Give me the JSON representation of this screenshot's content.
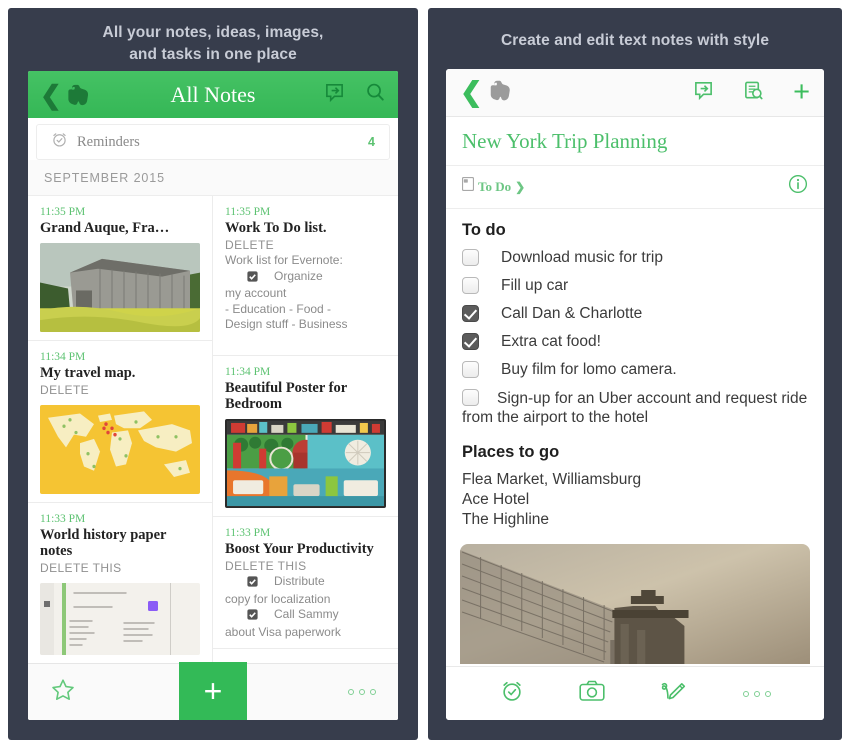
{
  "captions": {
    "left": "All your notes, ideas, images,\nand tasks in one place",
    "right": "Create and edit text notes with style"
  },
  "left_phone": {
    "navbar": {
      "back_icon": "chevron-left-icon",
      "logo_icon": "evernote-elephant-icon",
      "title": "All Notes",
      "share_icon": "share-icon",
      "search_icon": "search-icon"
    },
    "reminders": {
      "icon": "alarm-check-icon",
      "label": "Reminders",
      "count": "4"
    },
    "section_header": "SEPTEMBER 2015",
    "notes": [
      {
        "time": "11:35 PM",
        "title": "Grand Auque, Fra…",
        "subtitle": "",
        "body": "",
        "thumb": "barn-photo"
      },
      {
        "time": "11:35 PM",
        "title": "Work To Do list.",
        "subtitle": "DELETE",
        "body_line1": "Work list for Evernote:",
        "body_check1": "Organize",
        "body_line2": "my account",
        "body_line3": "- Education - Food -",
        "body_line4": "Design stuff - Business",
        "thumb": ""
      },
      {
        "time": "11:34 PM",
        "title": "My travel map.",
        "subtitle": "DELETE",
        "body": "",
        "thumb": "world-map"
      },
      {
        "time": "11:34 PM",
        "title": "Beautiful  Poster for Bedroom",
        "subtitle": "",
        "body": "",
        "thumb": "city-poster"
      },
      {
        "time": "11:33 PM",
        "title": "World history paper notes",
        "subtitle": "DELETE THIS",
        "body": "",
        "thumb": "handwritten-notes"
      },
      {
        "time": "11:33 PM",
        "title": "Boost Your Productivity",
        "subtitle": "DELETE THIS",
        "body_check1": "Distribute",
        "body_line2": "copy for localization",
        "body_check2": "Call Sammy",
        "body_line4": "about Visa paperwork",
        "thumb": ""
      }
    ],
    "toolbar": {
      "star_icon": "star-icon",
      "new_note_label": "+",
      "more_icon": "more-dots-icon"
    }
  },
  "right_phone": {
    "navbar": {
      "back_icon": "chevron-left-icon",
      "logo_icon": "evernote-elephant-icon",
      "share_icon": "share-icon",
      "note_info_icon": "note-search-icon",
      "add_label": "+"
    },
    "note_title": "New York Trip Planning",
    "notebook": {
      "icon": "notebook-icon",
      "name": "To Do",
      "chevron": "❯",
      "info_icon": "info-circle-icon"
    },
    "sections": [
      {
        "heading": "To do",
        "items": [
          {
            "checked": false,
            "label": "Download music for trip"
          },
          {
            "checked": false,
            "label": "Fill up car"
          },
          {
            "checked": true,
            "label": "Call Dan & Charlotte"
          },
          {
            "checked": true,
            "label": "Extra cat food!"
          },
          {
            "checked": false,
            "label": "Buy film for lomo camera."
          },
          {
            "checked": false,
            "label": "Sign-up for an Uber account and request ride from the airport to the hotel"
          }
        ]
      },
      {
        "heading": "Places to go",
        "lines": [
          "Flea Market, Williamsburg",
          "Ace Hotel",
          "The Highline"
        ]
      }
    ],
    "photo": "bridge-photo",
    "toolbar": {
      "reminder_icon": "alarm-check-icon",
      "camera_icon": "camera-icon",
      "handwrite_icon": "handwriting-pen-icon",
      "more_icon": "more-dots-icon"
    }
  },
  "colors": {
    "background_dark": "#373d4c",
    "evernote_green": "#3cbd5d",
    "accent_green_light": "#5cc271",
    "caption_text": "#c8ccd6"
  }
}
